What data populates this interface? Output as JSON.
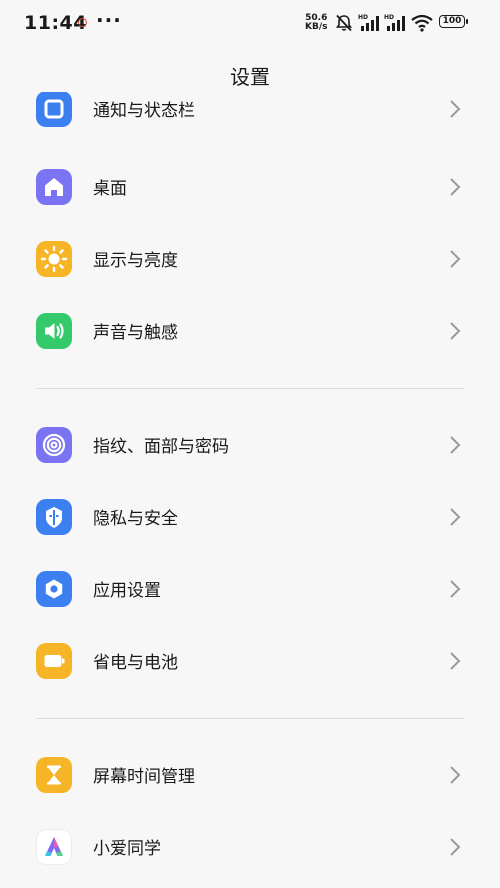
{
  "status_bar": {
    "time": "11:44",
    "more": "···",
    "net_speed_value": "50.6",
    "net_speed_unit": "KB/s",
    "hd_label": "HD",
    "battery": "100"
  },
  "header": {
    "title": "设置"
  },
  "groups": [
    {
      "items": [
        {
          "label": "通知与状态栏",
          "icon": "notification-icon",
          "color": "#3b7ff0"
        },
        {
          "label": "桌面",
          "icon": "home-icon",
          "color": "#7b74f2"
        },
        {
          "label": "显示与亮度",
          "icon": "sun-icon",
          "color": "#f6b526"
        },
        {
          "label": "声音与触感",
          "icon": "speaker-icon",
          "color": "#34c96a"
        }
      ]
    },
    {
      "items": [
        {
          "label": "指纹、面部与密码",
          "icon": "fingerprint-icon",
          "color": "#7b74f2"
        },
        {
          "label": "隐私与安全",
          "icon": "privacy-shield-icon",
          "color": "#3b7ff0"
        },
        {
          "label": "应用设置",
          "icon": "app-settings-icon",
          "color": "#3b7ff0"
        },
        {
          "label": "省电与电池",
          "icon": "battery-icon",
          "color": "#f6b526"
        }
      ]
    },
    {
      "items": [
        {
          "label": "屏幕时间管理",
          "icon": "hourglass-icon",
          "color": "#f6b526"
        },
        {
          "label": "小爱同学",
          "icon": "xiaoai-icon",
          "color": "#ffffff"
        }
      ]
    }
  ]
}
